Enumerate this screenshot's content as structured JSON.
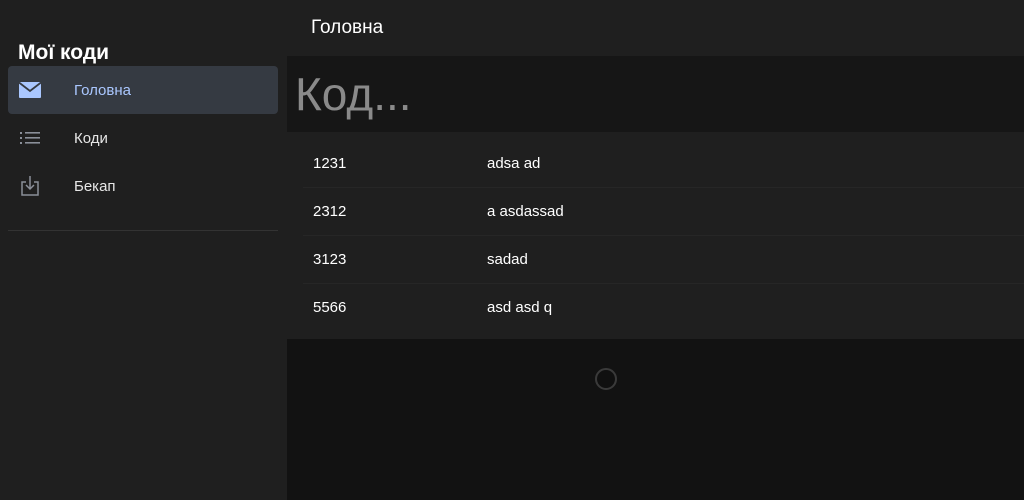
{
  "sidebar": {
    "title": "Мої коди",
    "items": [
      {
        "label": "Головна",
        "icon": "mail-icon",
        "active": true
      },
      {
        "label": "Коди",
        "icon": "list-icon",
        "active": false
      },
      {
        "label": "Бекап",
        "icon": "download-icon",
        "active": false
      }
    ]
  },
  "header": {
    "title": "Головна"
  },
  "search": {
    "placeholder": "Код..."
  },
  "codes": [
    {
      "code": "1231",
      "description": "adsa ad"
    },
    {
      "code": "2312",
      "description": "a asdassad"
    },
    {
      "code": "3123",
      "description": "sadad"
    },
    {
      "code": "5566",
      "description": "asd asd q"
    }
  ],
  "colors": {
    "accent": "#aac7ff",
    "active_background": "#353a42",
    "sidebar_background": "#1f1f1f",
    "page_background": "#121212"
  }
}
